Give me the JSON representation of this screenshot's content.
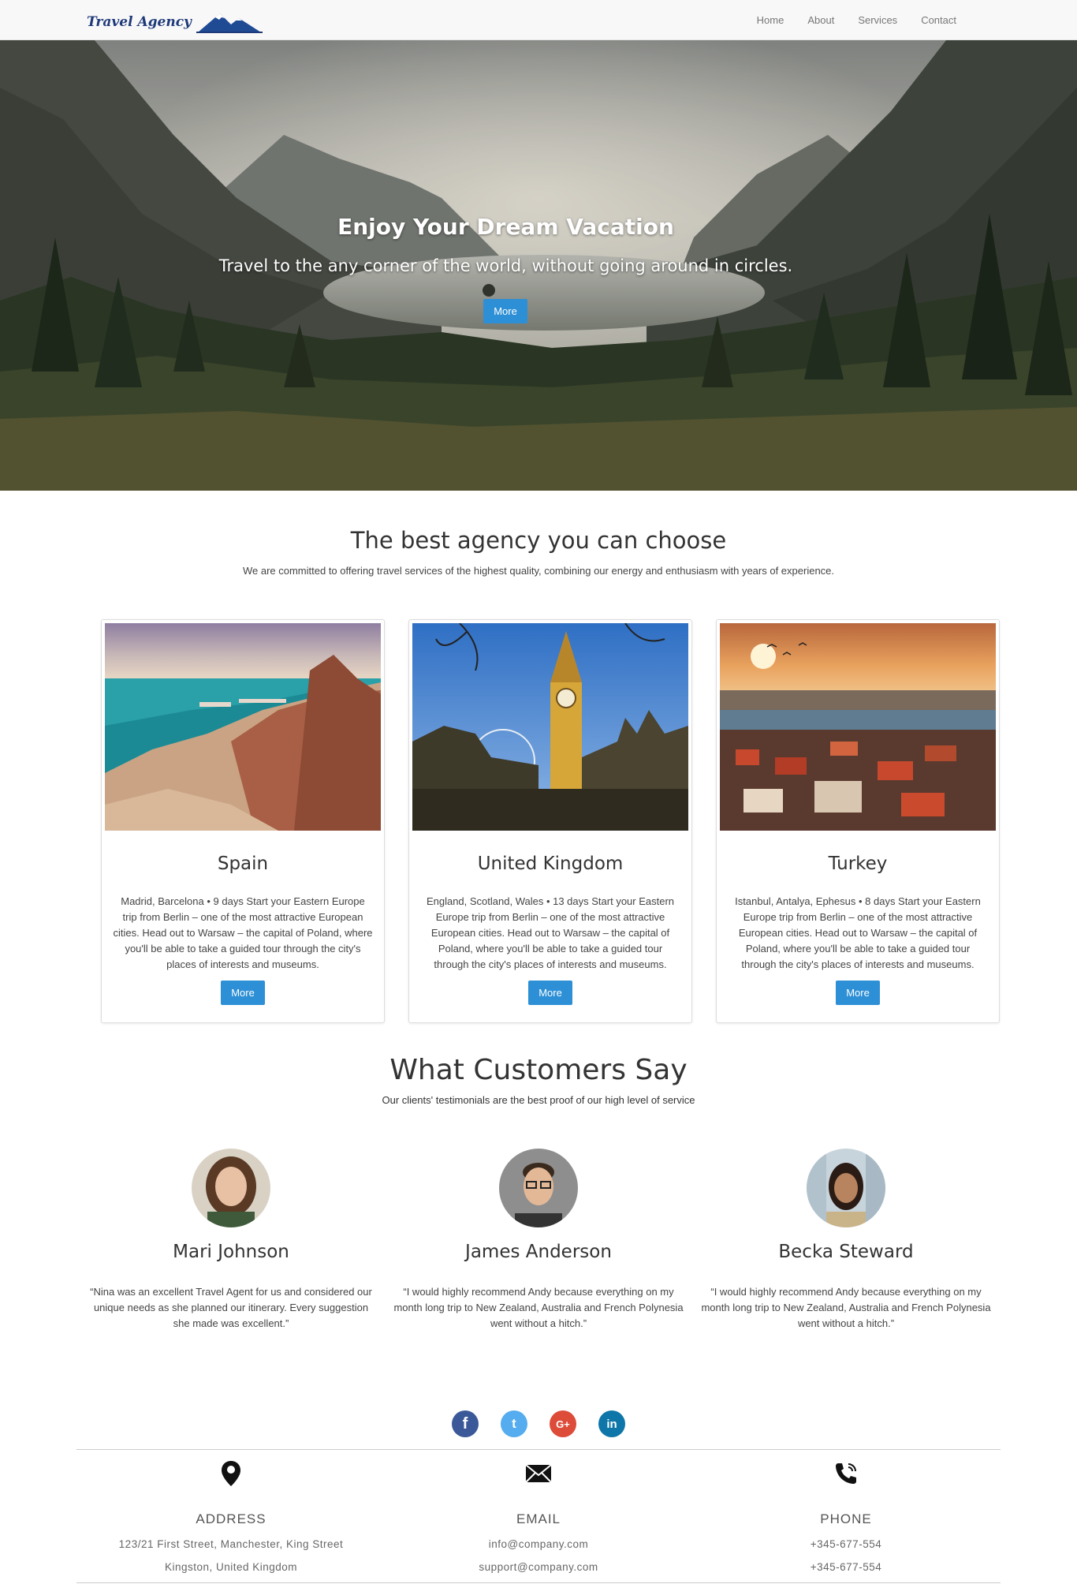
{
  "nav": {
    "logo_text": "Travel Agency",
    "links": [
      "Home",
      "About",
      "Services",
      "Contact"
    ]
  },
  "hero": {
    "title": "Enjoy Your Dream Vacation",
    "subtitle": "Travel to the any corner of the world, without going around in circles.",
    "button": "More"
  },
  "agency": {
    "title": "The best agency you can choose",
    "subtitle": "We are committed to offering travel services of the highest quality, combining our energy and enthusiasm with years of experience."
  },
  "destinations": [
    {
      "title": "Spain",
      "text": "Madrid, Barcelona • 9 days Start your Eastern Europe trip from Berlin – one of the most attractive European cities. Head out to Warsaw – the capital of Poland, where you'll be able to take a guided tour through the city's places of interests and museums.",
      "button": "More"
    },
    {
      "title": "United Kingdom",
      "text": "England, Scotland, Wales • 13 days Start your Eastern Europe trip from Berlin – one of the most attractive European cities. Head out to Warsaw – the capital of Poland, where you'll be able to take a guided tour through the city's places of interests and museums.",
      "button": "More"
    },
    {
      "title": "Turkey",
      "text": "Istanbul, Antalya, Ephesus • 8 days Start your Eastern Europe trip from Berlin – one of the most attractive European cities. Head out to Warsaw – the capital of Poland, where you'll be able to take a guided tour through the city's places of interests and museums.",
      "button": "More"
    }
  ],
  "customers": {
    "title": "What Customers Say",
    "subtitle": "Our clients' testimonials are the best proof of our high level of service",
    "items": [
      {
        "name": "Mari Johnson",
        "text": "“Nina was an excellent Travel Agent for us and considered our unique needs as she planned our itinerary. Every suggestion she made was excellent.”"
      },
      {
        "name": "James Anderson",
        "text": "“I would highly recommend Andy because everything on my month long trip to New Zealand, Australia and French Polynesia went without a hitch.”"
      },
      {
        "name": "Becka Steward",
        "text": "“I would highly recommend Andy because everything on my month long trip to New Zealand, Australia and French Polynesia went without a hitch.”"
      }
    ]
  },
  "social": [
    {
      "icon": "facebook-icon",
      "glyph": "f",
      "color": "#3b5998"
    },
    {
      "icon": "twitter-icon",
      "glyph": "t",
      "color": "#55acee"
    },
    {
      "icon": "google-plus-icon",
      "glyph": "G+",
      "color": "#dd4b39"
    },
    {
      "icon": "linkedin-icon",
      "glyph": "in",
      "color": "#0e76a8"
    }
  ],
  "footer": {
    "address": {
      "icon": "map-pin-icon",
      "heading": "ADDRESS",
      "line1": "123/21 First Street, Manchester, King Street",
      "line2": "Kingston, United Kingdom"
    },
    "email": {
      "icon": "envelope-icon",
      "heading": "EMAIL",
      "line1": "info@company.com",
      "line2": "support@company.com"
    },
    "phone": {
      "icon": "phone-icon",
      "heading": "PHONE",
      "line1": "+345-677-554",
      "line2": "+345-677-554"
    }
  },
  "colors": {
    "accent": "#2d8fd5",
    "nav_bg": "#f8f8f8"
  }
}
